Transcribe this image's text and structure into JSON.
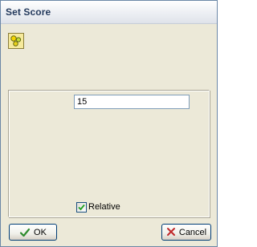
{
  "window": {
    "title": "Set Score"
  },
  "toolbar": {
    "icon": "bubbles-icon"
  },
  "score_field": {
    "value": "15"
  },
  "relative_option": {
    "label": "Relative",
    "checked": true
  },
  "buttons": {
    "ok": {
      "label": "OK",
      "icon": "checkmark-icon",
      "color": "#2e8b2e"
    },
    "cancel": {
      "label": "Cancel",
      "icon": "x-icon",
      "color": "#c0282a"
    }
  }
}
